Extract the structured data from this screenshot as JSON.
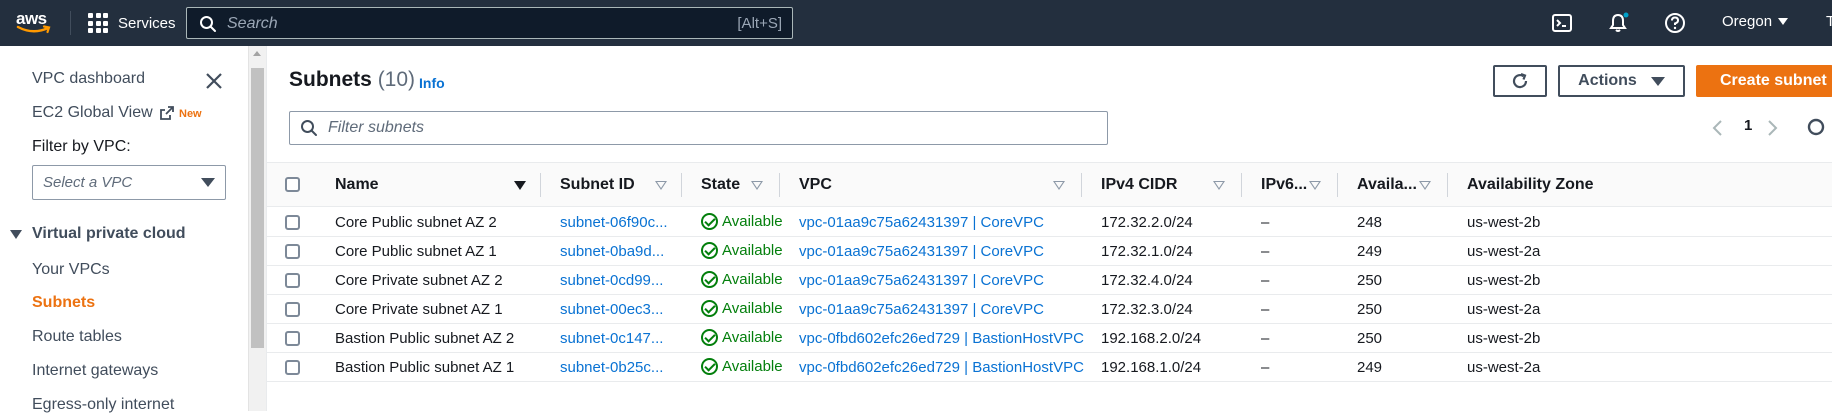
{
  "topnav": {
    "logo_text": "aws",
    "services_label": "Services",
    "search_placeholder": "Search",
    "search_shortcut": "[Alt+S]",
    "region": "Oregon",
    "account_trunc": "T"
  },
  "sidebar": {
    "items_top": [
      {
        "label": "VPC dashboard"
      },
      {
        "label": "EC2 Global View"
      }
    ],
    "new_badge": "New",
    "filter_label": "Filter by VPC:",
    "vpc_select_placeholder": "Select a VPC",
    "section_title": "Virtual private cloud",
    "section_items": [
      {
        "label": "Your VPCs",
        "active": false
      },
      {
        "label": "Subnets",
        "active": true
      },
      {
        "label": "Route tables",
        "active": false
      },
      {
        "label": "Internet gateways",
        "active": false
      },
      {
        "label": "Egress-only internet",
        "active": false
      }
    ]
  },
  "main": {
    "title": "Subnets",
    "count": "(10)",
    "info": "Info",
    "actions_label": "Actions",
    "create_label": "Create subnet",
    "filter_placeholder": "Filter subnets",
    "page": "1",
    "columns": [
      "Name",
      "Subnet ID",
      "State",
      "VPC",
      "IPv4 CIDR",
      "IPv6...",
      "Availa...",
      "Availability Zone"
    ],
    "rows": [
      {
        "name": "Core Public subnet AZ 2",
        "subnet_id": "subnet-06f90c...",
        "state": "Available",
        "vpc": "vpc-01aa9c75a62431397 | CoreVPC",
        "ipv4": "172.32.2.0/24",
        "ipv6": "–",
        "avail": "248",
        "az": "us-west-2b"
      },
      {
        "name": "Core Public subnet AZ 1",
        "subnet_id": "subnet-0ba9d...",
        "state": "Available",
        "vpc": "vpc-01aa9c75a62431397 | CoreVPC",
        "ipv4": "172.32.1.0/24",
        "ipv6": "–",
        "avail": "249",
        "az": "us-west-2a"
      },
      {
        "name": "Core Private subnet AZ 2",
        "subnet_id": "subnet-0cd99...",
        "state": "Available",
        "vpc": "vpc-01aa9c75a62431397 | CoreVPC",
        "ipv4": "172.32.4.0/24",
        "ipv6": "–",
        "avail": "250",
        "az": "us-west-2b"
      },
      {
        "name": "Core Private subnet AZ 1",
        "subnet_id": "subnet-00ec3...",
        "state": "Available",
        "vpc": "vpc-01aa9c75a62431397 | CoreVPC",
        "ipv4": "172.32.3.0/24",
        "ipv6": "–",
        "avail": "250",
        "az": "us-west-2a"
      },
      {
        "name": "Bastion Public subnet AZ 2",
        "subnet_id": "subnet-0c147...",
        "state": "Available",
        "vpc": "vpc-0fbd602efc26ed729 | BastionHostVPC",
        "ipv4": "192.168.2.0/24",
        "ipv6": "–",
        "avail": "250",
        "az": "us-west-2b"
      },
      {
        "name": "Bastion Public subnet AZ 1",
        "subnet_id": "subnet-0b25c...",
        "state": "Available",
        "vpc": "vpc-0fbd602efc26ed729 | BastionHostVPC",
        "ipv4": "192.168.1.0/24",
        "ipv6": "–",
        "avail": "249",
        "az": "us-west-2a"
      }
    ]
  }
}
